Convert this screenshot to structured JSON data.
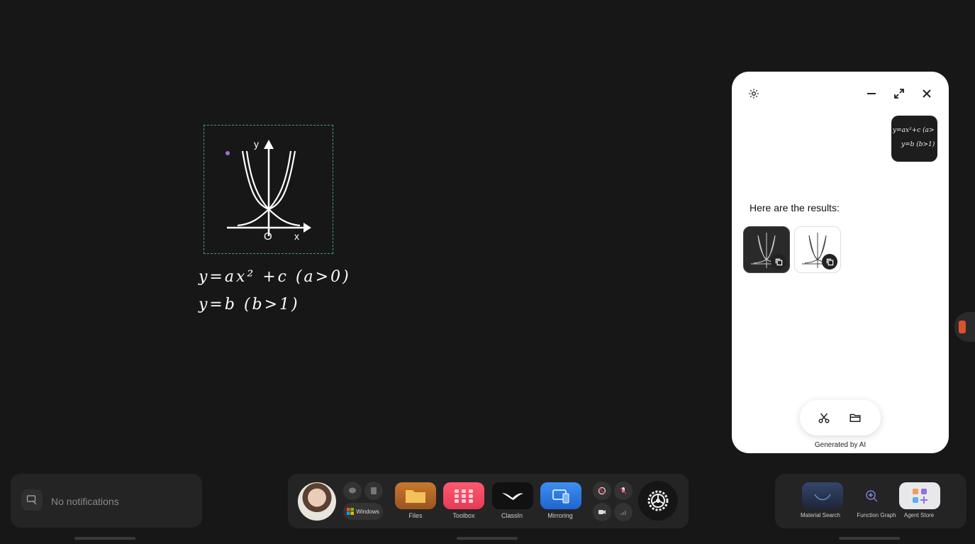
{
  "canvas": {
    "graph": {
      "y_axis_label": "y",
      "x_axis_label": "x",
      "origin_label": "O"
    },
    "handwriting": {
      "line1": "y=ax² +c (a>0)",
      "line2": "y=b (b>1)"
    }
  },
  "ai_panel": {
    "query_thumbnail_text": [
      "y=ax²+c (a>",
      "y=b (b>1)"
    ],
    "results_text": "Here are the results:",
    "footer_label": "Generated by AI"
  },
  "notifications": {
    "text": "No notifications"
  },
  "dock": {
    "windows_label": "Windows",
    "apps": [
      {
        "label": "Files",
        "color": "#b0682a"
      },
      {
        "label": "Toolbox",
        "color": "#ef4b65"
      },
      {
        "label": "ClassIn",
        "color": "#111111"
      },
      {
        "label": "Mirroring",
        "color": "#2f7fe8"
      }
    ]
  },
  "right_dock": {
    "items": [
      {
        "label": "Material Search"
      },
      {
        "label": "Function Graph"
      },
      {
        "label": "Agent Store"
      }
    ]
  }
}
